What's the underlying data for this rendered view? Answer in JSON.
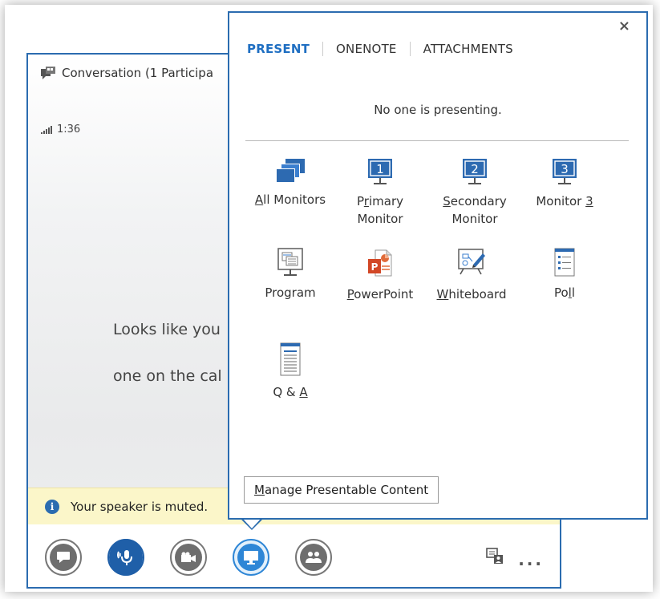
{
  "conversation": {
    "title": "Conversation (1 Participa",
    "call_timer": "1:36",
    "center_message_line1": "Looks like you",
    "center_message_line2": "one on the cal",
    "notice": "Your speaker is muted.",
    "colors": {
      "accent": "#2b6cb0",
      "notice_bg": "#fbf6c9"
    }
  },
  "toolbar": {
    "buttons": [
      {
        "icon": "chat-bubble-icon"
      },
      {
        "icon": "microphone-icon"
      },
      {
        "icon": "video-camera-icon"
      },
      {
        "icon": "present-monitor-icon"
      },
      {
        "icon": "participants-icon"
      }
    ],
    "right_icons": [
      "present-content-icon",
      "more-options-icon"
    ],
    "more_label": "..."
  },
  "popup": {
    "close_label": "×",
    "tabs": [
      "PRESENT",
      "ONENOTE",
      "ATTACHMENTS"
    ],
    "selected_tab": "PRESENT",
    "status": "No one is presenting.",
    "items": [
      {
        "label": "All Monitors",
        "underline": "A",
        "rest": "ll Monitors",
        "icon": "all-monitors-icon"
      },
      {
        "label": "Primary Monitor",
        "l1a": "P",
        "l1u": "r",
        "l1b": "imary",
        "l2": "Monitor",
        "icon": "monitor-1-icon"
      },
      {
        "label": "Secondary Monitor",
        "l1u": "S",
        "l1b": "econdary",
        "l2": "Monitor",
        "icon": "monitor-2-icon"
      },
      {
        "label": "Monitor 3",
        "l1a": "Monitor ",
        "l1u": "3",
        "icon": "monitor-3-icon"
      },
      {
        "label": "Program",
        "icon": "program-icon"
      },
      {
        "label": "PowerPoint",
        "l1u": "P",
        "l1b": "owerPoint",
        "icon": "powerpoint-icon"
      },
      {
        "label": "Whiteboard",
        "l1u": "W",
        "l1b": "hiteboard",
        "icon": "whiteboard-icon"
      },
      {
        "label": "Poll",
        "l1a": "Po",
        "l1u": "l",
        "l1b": "l",
        "icon": "poll-icon"
      },
      {
        "label": "Q & A",
        "l1a": "Q & ",
        "l1u": "A",
        "icon": "qa-icon"
      }
    ],
    "monitor_numbers": [
      "1",
      "2",
      "3"
    ],
    "manage_button": "Manage Presentable Content",
    "manage_underline": "M",
    "manage_rest": "anage Presentable Content",
    "colors": {
      "selected_tab": "#1f6fc2",
      "icon_blue": "#2d6ab1"
    }
  }
}
